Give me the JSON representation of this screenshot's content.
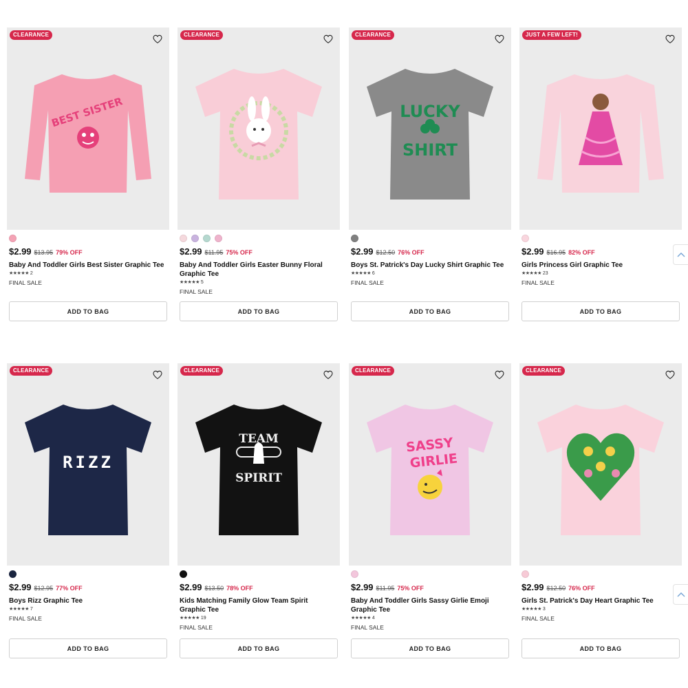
{
  "products": [
    {
      "badge": "CLEARANCE",
      "swatches": [
        "#f4a3b5"
      ],
      "price": "$2.99",
      "original": "$13.95",
      "off": "79% OFF",
      "name": "Baby And Toddler Girls Best Sister Graphic Tee",
      "stars": "★★★★★",
      "reviews": "2",
      "final": "FINAL SALE",
      "button": "ADD TO BAG",
      "shirt_color": "#f59fb3",
      "graphic_text": "BEST SISTER"
    },
    {
      "badge": "CLEARANCE",
      "swatches": [
        "#f5d9dd",
        "#c9b3df",
        "#b5d8cf",
        "#efb3cc"
      ],
      "price": "$2.99",
      "original": "$11.95",
      "off": "75% OFF",
      "name": "Baby And Toddler Girls Easter Bunny Floral Graphic Tee",
      "stars": "★★★★★",
      "reviews": "5",
      "final": "FINAL SALE",
      "button": "ADD TO BAG",
      "shirt_color": "#f9cdd7",
      "graphic_text": ""
    },
    {
      "badge": "CLEARANCE",
      "swatches": [
        "#808080"
      ],
      "price": "$2.99",
      "original": "$12.50",
      "off": "76% OFF",
      "name": "Boys St. Patrick's Day Lucky Shirt Graphic Tee",
      "stars": "★★★★★",
      "reviews": "6",
      "final": "FINAL SALE",
      "button": "ADD TO BAG",
      "shirt_color": "#8a8a8a",
      "graphic_text": "LUCKY SHIRT"
    },
    {
      "badge": "JUST A FEW LEFT!",
      "swatches": [
        "#f9d6de"
      ],
      "price": "$2.99",
      "original": "$16.95",
      "off": "82% OFF",
      "name": "Girls Princess Girl Graphic Tee",
      "stars": "★★★★★",
      "reviews": "23",
      "final": "FINAL SALE",
      "button": "ADD TO BAG",
      "shirt_color": "#f9d3dc",
      "graphic_text": ""
    },
    {
      "badge": "CLEARANCE",
      "swatches": [
        "#1b2540"
      ],
      "price": "$2.99",
      "original": "$12.95",
      "off": "77% OFF",
      "name": "Boys Rizz Graphic Tee",
      "stars": "★★★★★",
      "reviews": "7",
      "final": "FINAL SALE",
      "button": "ADD TO BAG",
      "shirt_color": "#1d2747",
      "graphic_text": "RIZZ"
    },
    {
      "badge": "CLEARANCE",
      "swatches": [
        "#111111"
      ],
      "price": "$2.99",
      "original": "$13.50",
      "off": "78% OFF",
      "name": "Kids Matching Family Glow Team Spirit Graphic Tee",
      "stars": "★★★★★",
      "reviews": "19",
      "final": "FINAL SALE",
      "button": "ADD TO BAG",
      "shirt_color": "#121212",
      "graphic_text": "TEAM SPIRIT"
    },
    {
      "badge": "CLEARANCE",
      "swatches": [
        "#f3c6dc"
      ],
      "price": "$2.99",
      "original": "$11.95",
      "off": "75% OFF",
      "name": "Baby And Toddler Girls Sassy Girlie Emoji Graphic Tee",
      "stars": "★★★★★",
      "reviews": "4",
      "final": "FINAL SALE",
      "button": "ADD TO BAG",
      "shirt_color": "#f0c6e4",
      "graphic_text": "SASSY GIRLIE"
    },
    {
      "badge": "CLEARANCE",
      "swatches": [
        "#f7cad6"
      ],
      "price": "$2.99",
      "original": "$12.50",
      "off": "76% OFF",
      "name": "Girls St. Patrick's Day Heart Graphic Tee",
      "stars": "★★★★★",
      "reviews": "3",
      "final": "FINAL SALE",
      "button": "ADD TO BAG",
      "shirt_color": "#fad2dc",
      "graphic_text": ""
    }
  ],
  "icons": {
    "wishlist": "heart-outline-icon",
    "scroll": "chevron-up-icon"
  },
  "colors": {
    "badge": "#d6284c",
    "discount": "#d6284c",
    "image_bg": "#ebebeb"
  }
}
